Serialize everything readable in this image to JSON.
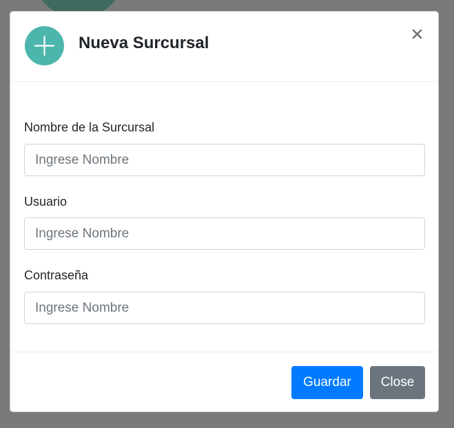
{
  "modal": {
    "title": "Nueva Surcursal",
    "close_icon": "close-icon",
    "header_icon": "plus-icon",
    "icon_color": "#4db6ac"
  },
  "form": {
    "fields": [
      {
        "label": "Nombre de la Surcursal",
        "placeholder": "Ingrese Nombre",
        "value": ""
      },
      {
        "label": "Usuario",
        "placeholder": "Ingrese Nombre",
        "value": ""
      },
      {
        "label": "Contraseña",
        "placeholder": "Ingrese Nombre",
        "value": ""
      }
    ]
  },
  "footer": {
    "save_label": "Guardar",
    "close_label": "Close",
    "save_color": "#007bff",
    "close_color": "#6c757d"
  }
}
